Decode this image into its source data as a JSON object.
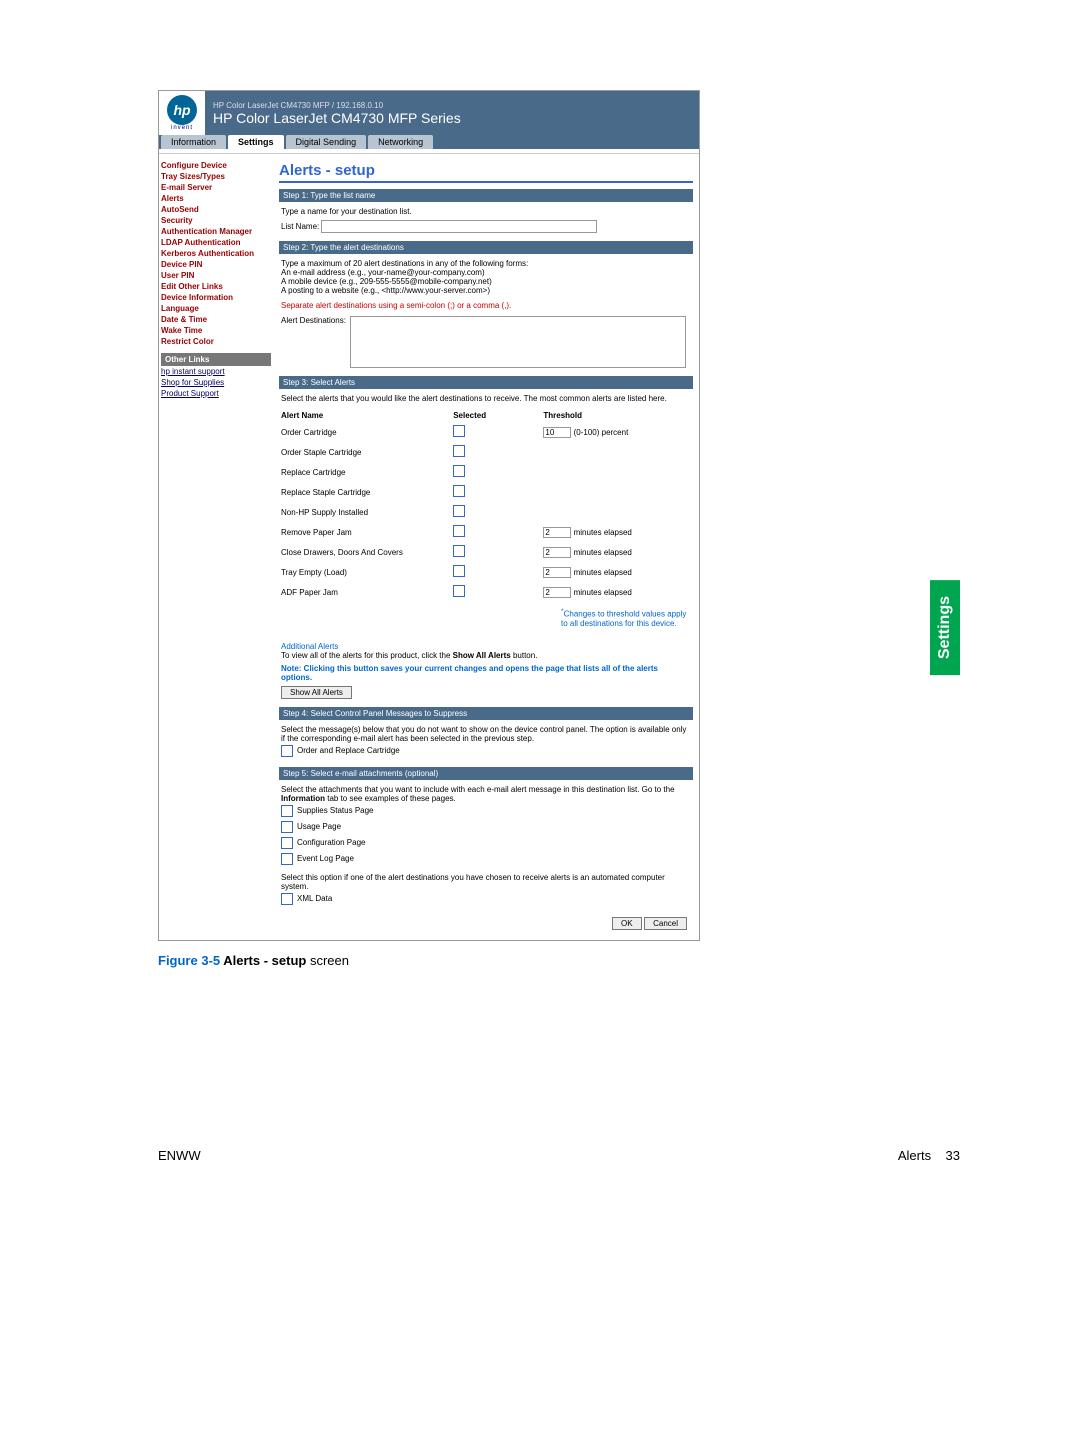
{
  "header": {
    "small_title": "HP Color LaserJet CM4730 MFP / 192.168.0.10",
    "big_title": "HP Color LaserJet CM4730 MFP Series",
    "logo_text": "hp",
    "logo_sub": "invent"
  },
  "tabs": [
    "Information",
    "Settings",
    "Digital Sending",
    "Networking"
  ],
  "tabs_active": 1,
  "sidebar": [
    "Configure Device",
    "Tray Sizes/Types",
    "E-mail Server",
    "Alerts",
    "AutoSend",
    "Security",
    "Authentication Manager",
    "LDAP Authentication",
    "Kerberos Authentication",
    "Device PIN",
    "User PIN",
    "Edit Other Links",
    "Device Information",
    "Language",
    "Date & Time",
    "Wake Time",
    "Restrict Color"
  ],
  "sidebar_active": 3,
  "other_links_header": "Other Links",
  "other_links": [
    "hp instant support",
    "Shop for Supplies",
    "Product Support"
  ],
  "page_title": "Alerts - setup",
  "step1": {
    "header": "Step 1: Type the list name",
    "desc": "Type a name for your destination list.",
    "label": "List Name:"
  },
  "step2": {
    "header": "Step 2: Type the alert destinations",
    "desc1": "Type a maximum of 20 alert destinations in any of the following forms:",
    "line1": "An e-mail address (e.g., your-name@your-company.com)",
    "line2": "A mobile device (e.g., 209-555-5555@mobile-company.net)",
    "line3": "A posting to a website (e.g., <http://www.your-server.com>)",
    "sep_note": "Separate alert destinations using a semi-colon (;) or a comma (,).",
    "dest_label": "Alert Destinations:"
  },
  "step3": {
    "header": "Step 3: Select Alerts",
    "desc": "Select the alerts that you would like the alert destinations to receive. The most common alerts are listed here.",
    "col_alert": "Alert Name",
    "col_sel": "Selected",
    "col_thr": "Threshold",
    "rows": [
      {
        "name": "Order Cartridge",
        "threshold": "10",
        "unit": "(0-100) percent"
      },
      {
        "name": "Order Staple Cartridge",
        "threshold": "",
        "unit": ""
      },
      {
        "name": "Replace Cartridge",
        "threshold": "",
        "unit": ""
      },
      {
        "name": "Replace Staple Cartridge",
        "threshold": "",
        "unit": ""
      },
      {
        "name": "Non-HP Supply Installed",
        "threshold": "",
        "unit": ""
      },
      {
        "name": "Remove Paper Jam",
        "threshold": "2",
        "unit": "minutes elapsed"
      },
      {
        "name": "Close Drawers, Doors And Covers",
        "threshold": "2",
        "unit": "minutes elapsed"
      },
      {
        "name": "Tray Empty (Load)",
        "threshold": "2",
        "unit": "minutes elapsed"
      },
      {
        "name": "ADF Paper Jam",
        "threshold": "2",
        "unit": "minutes elapsed"
      }
    ],
    "changes_note": "Changes to threshold values apply to all destinations for this device.",
    "add_alerts": "Additional Alerts",
    "add_alerts_desc_a": "To view all of the alerts for this product, click the ",
    "add_alerts_desc_b": "Show All Alerts",
    "add_alerts_desc_c": " button.",
    "save_note": "Note: Clicking this button saves your current changes and opens the page that lists all of the alerts options.",
    "show_all_btn": "Show All Alerts"
  },
  "step4": {
    "header": "Step 4: Select Control Panel Messages to Suppress",
    "desc": "Select the message(s) below that you do not want to show on the device control panel. The option is available only if the corresponding e-mail alert has been selected in the previous step.",
    "item1": "Order and Replace Cartridge"
  },
  "step5": {
    "header": "Step 5: Select e-mail attachments (optional)",
    "desc_a": "Select the attachments that you want to include with each e-mail alert message in this destination list. Go to the ",
    "desc_b": "Information",
    "desc_c": " tab to see examples of these pages.",
    "items": [
      "Supplies Status Page",
      "Usage Page",
      "Configuration Page",
      "Event Log Page"
    ],
    "xml_desc": "Select this option if one of the alert destinations you have chosen to receive alerts is an automated computer system.",
    "xml_item": "XML Data"
  },
  "buttons": {
    "ok": "OK",
    "cancel": "Cancel"
  },
  "settings_tab": "Settings",
  "caption": {
    "fig": "Figure 3-5",
    "rest_a": "  Alerts - setup",
    "rest_b": " screen"
  },
  "footer": {
    "left": "ENWW",
    "right_label": "Alerts",
    "right_page": "33"
  }
}
